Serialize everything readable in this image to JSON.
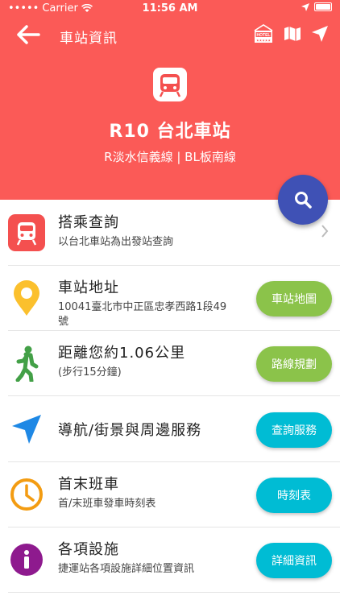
{
  "status": {
    "carrier": "Carrier",
    "time": "11:56 AM"
  },
  "nav": {
    "title": "車站資訊",
    "hotel_badge": "HOTEL"
  },
  "station": {
    "name": "R10 台北車站",
    "lines": "R淡水信義線 | BL板南線"
  },
  "rows": [
    {
      "title": "搭乘查詢",
      "subtitle": "以台北車站為出發站查詢"
    },
    {
      "title": "車站地址",
      "subtitle": "10041臺北市中正區忠孝西路1段49號",
      "button": "車站地圖",
      "button_color": "#8bc34a"
    },
    {
      "title": "距離您約1.06公里",
      "subtitle": "(步行15分鐘)",
      "button": "路線規劃",
      "button_color": "#8bc34a"
    },
    {
      "title": "導航/街景與周邊服務",
      "button": "查詢服務",
      "button_color": "#00bcd4"
    },
    {
      "title": "首末班車",
      "subtitle": "首/末班車發車時刻表",
      "button": "時刻表",
      "button_color": "#00bcd4"
    },
    {
      "title": "各項設施",
      "subtitle": "捷運站各項設施詳細位置資訊",
      "button": "詳細資訊",
      "button_color": "#00bcd4"
    }
  ],
  "colors": {
    "header": "#fb5a57",
    "fab": "#3f51b5",
    "train_icon": "#f4504f",
    "pin": "#fbc02d",
    "walk": "#43a047",
    "navigate": "#1e88e5",
    "clock": "#f39c12",
    "info": "#8e1a8e"
  }
}
